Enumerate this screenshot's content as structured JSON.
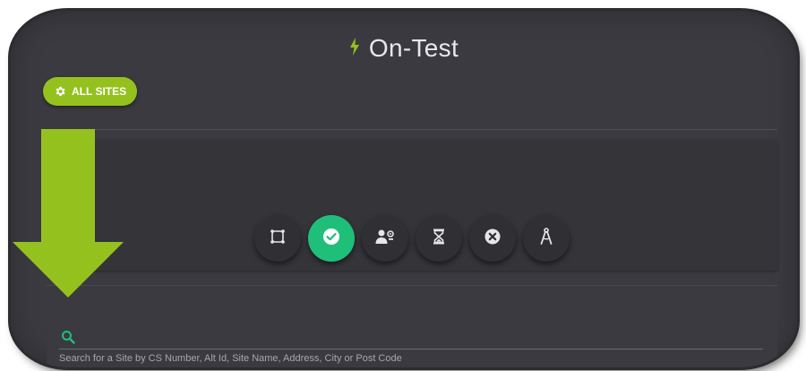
{
  "header": {
    "title": "On-Test",
    "bolt_icon": "lightning-bolt-icon",
    "bolt_color": "#95c11f"
  },
  "filter_button": {
    "label": "ALL SITES",
    "icon": "gear-icon",
    "color": "#95c11f"
  },
  "toolbar": {
    "items": [
      {
        "name": "frame-icon",
        "active": false
      },
      {
        "name": "check-circle-icon",
        "active": true
      },
      {
        "name": "user-settings-icon",
        "active": false
      },
      {
        "name": "hourglass-icon",
        "active": false
      },
      {
        "name": "cancel-circle-icon",
        "active": false
      },
      {
        "name": "compass-icon",
        "active": false
      }
    ],
    "active_color": "#1fbf7a"
  },
  "search": {
    "icon": "search-icon",
    "hint": "Search for a Site by CS Number, Alt Id, Site Name, Address, City or Post Code",
    "icon_color": "#1fbf7a"
  },
  "annotation": {
    "arrow_icon": "down-arrow-icon",
    "arrow_color": "#95c11f"
  }
}
